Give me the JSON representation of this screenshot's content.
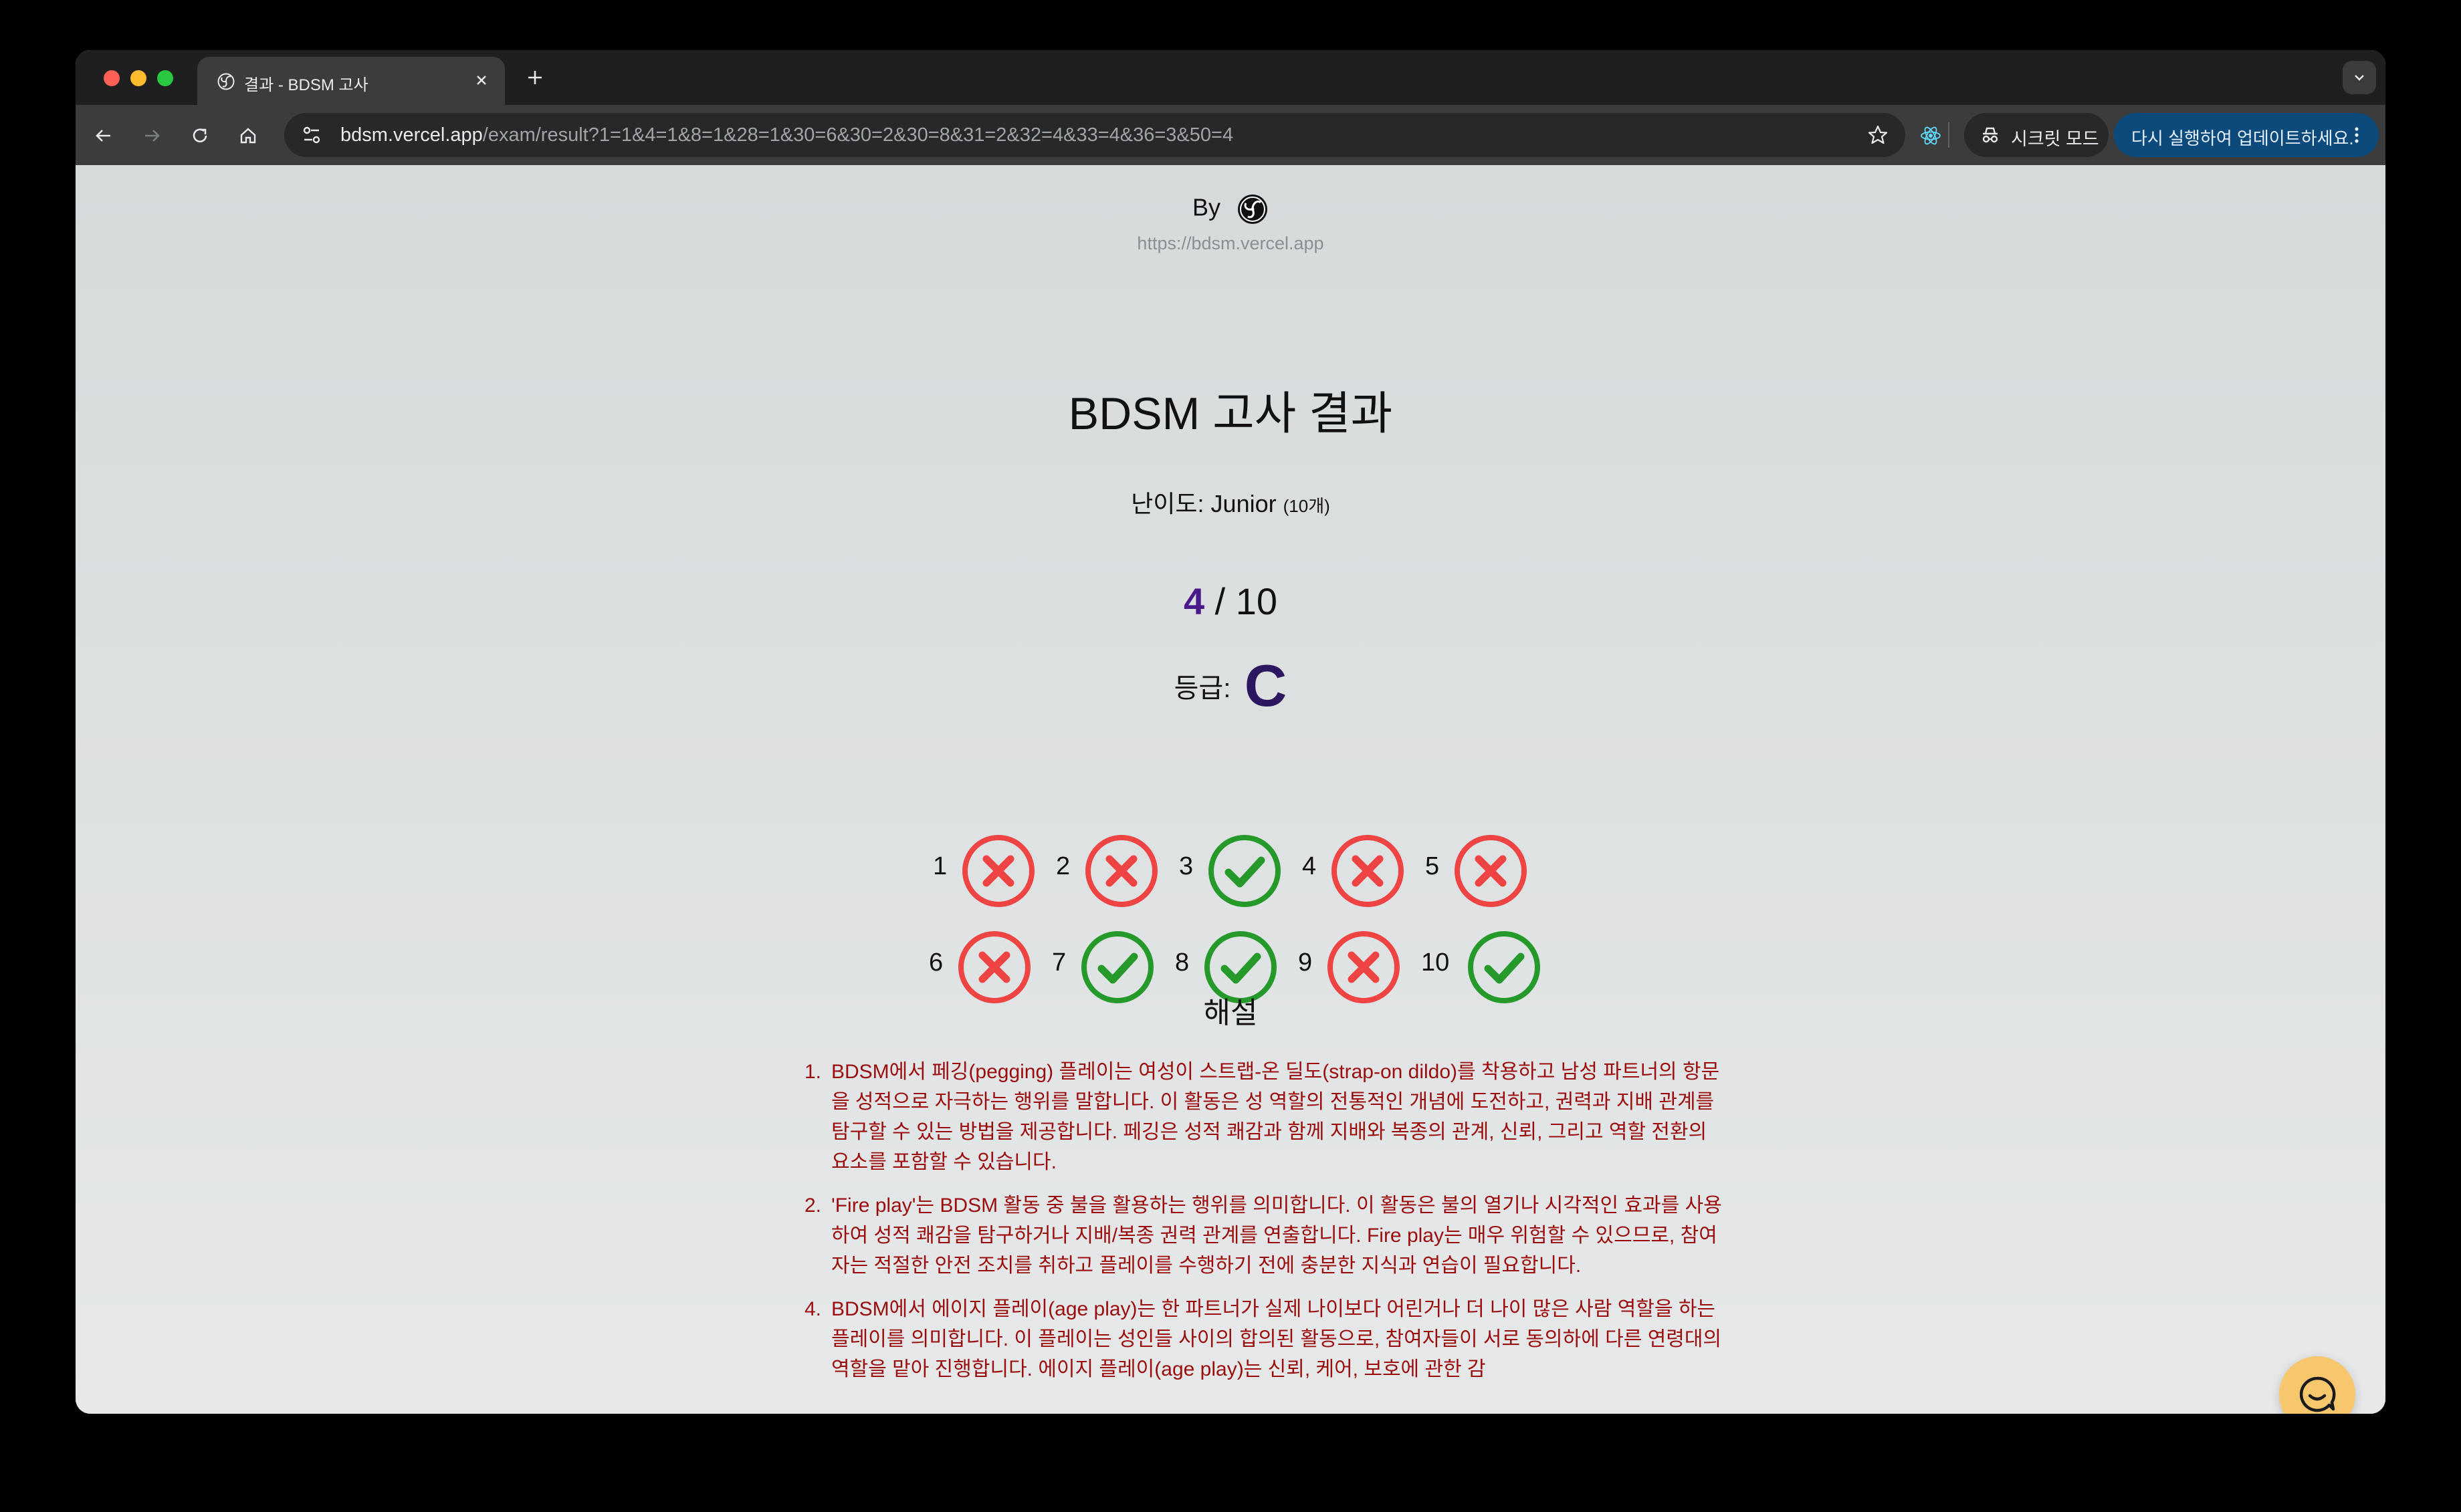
{
  "browser": {
    "tab_title": "결과 - BDSM 고사",
    "url_host": "bdsm.vercel.app",
    "url_path": "/exam/result?1=1&4=1&8=1&28=1&30=6&30=2&30=8&31=2&32=4&33=4&36=3&50=4",
    "incognito_label": "시크릿 모드",
    "update_label": "다시 실행하여 업데이트하세요."
  },
  "header": {
    "by_label": "By",
    "site_url": "https://bdsm.vercel.app"
  },
  "result": {
    "title": "BDSM 고사 결과",
    "level_label": "난이도: Junior",
    "level_count": "(10개)",
    "score_correct": "4",
    "score_total": "/ 10",
    "grade_label": "등급:",
    "grade_value": "C"
  },
  "questions": [
    {
      "num": "1",
      "correct": false
    },
    {
      "num": "2",
      "correct": false
    },
    {
      "num": "3",
      "correct": true
    },
    {
      "num": "4",
      "correct": false
    },
    {
      "num": "5",
      "correct": false
    },
    {
      "num": "6",
      "correct": false
    },
    {
      "num": "7",
      "correct": true
    },
    {
      "num": "8",
      "correct": true
    },
    {
      "num": "9",
      "correct": false
    },
    {
      "num": "10",
      "correct": true
    }
  ],
  "explanation": {
    "title": "해설",
    "items": [
      {
        "num": "1.",
        "text": "BDSM에서 페깅(pegging) 플레이는 여성이 스트랩-온 딜도(strap-on dildo)를 착용하고 남성 파트너의 항문을 성적으로 자극하는 행위를 말합니다. 이 활동은 성 역할의 전통적인 개념에 도전하고, 권력과 지배 관계를 탐구할 수 있는 방법을 제공합니다. 페깅은 성적 쾌감과 함께 지배와 복종의 관계, 신뢰, 그리고 역할 전환의 요소를 포함할 수 있습니다."
      },
      {
        "num": "2.",
        "text": "'Fire play'는 BDSM 활동 중 불을 활용하는 행위를 의미합니다. 이 활동은 불의 열기나 시각적인 효과를 사용하여 성적 쾌감을 탐구하거나 지배/복종 권력 관계를 연출합니다. Fire play는 매우 위험할 수 있으므로, 참여자는 적절한 안전 조치를 취하고 플레이를 수행하기 전에 충분한 지식과 연습이 필요합니다."
      },
      {
        "num": "4.",
        "text": "BDSM에서 에이지 플레이(age play)는 한 파트너가 실제 나이보다 어린거나 더 나이 많은 사람 역할을 하는 플레이를 의미합니다. 이 플레이는 성인들 사이의 합의된 활동으로, 참여자들이 서로 동의하에 다른 연령대의 역할을 맡아 진행합니다. 에이지 플레이(age play)는 신뢰, 케어, 보호에 관한 감"
      }
    ]
  },
  "colors": {
    "correct": "#26992b",
    "wrong": "#ef4444",
    "score_accent": "#4b1a8a",
    "grade_accent": "#2d1660",
    "explanation_text": "#9b0d0d",
    "chat_button": "#f7c76e"
  }
}
